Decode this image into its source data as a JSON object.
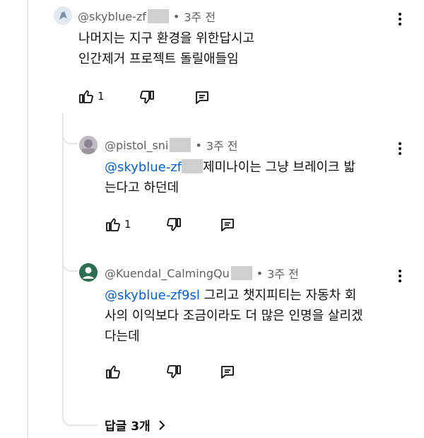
{
  "comments": [
    {
      "author": "@skyblue-zf",
      "time": "3주 전",
      "lines": [
        "나머지는 지구 환경을 위한답시고",
        "인간제거 프로젝트 돌릴애들임"
      ],
      "likes": "1"
    },
    {
      "author": "@pistol_sni",
      "time": "3주 전",
      "mention": "@skyblue-zf",
      "line1_rest": "제미나이는 그냥 브레이크 밟",
      "line2": "는다고 하던데",
      "likes": "1"
    },
    {
      "author": "@Kuendal_CalmingQu",
      "time": "3주 전",
      "mention": "@skyblue-zf9sl",
      "line1_rest": " 그리고 챗지피티는 자동차 회",
      "line2": "사의 이익보다 조금이라도 더 많은 인명을 살리겠",
      "line3": "다는데"
    }
  ],
  "replies_label": "답글 3개",
  "icons": {
    "like": "thumbs-up-icon",
    "dislike": "thumbs-down-icon",
    "reply": "reply-comment-icon",
    "menu": "more-vert-icon",
    "chevron": "chevron-right-icon"
  },
  "colors": {
    "mention": "#065fd4",
    "thread_line": "#e5e5e5",
    "meta": "#606060"
  }
}
